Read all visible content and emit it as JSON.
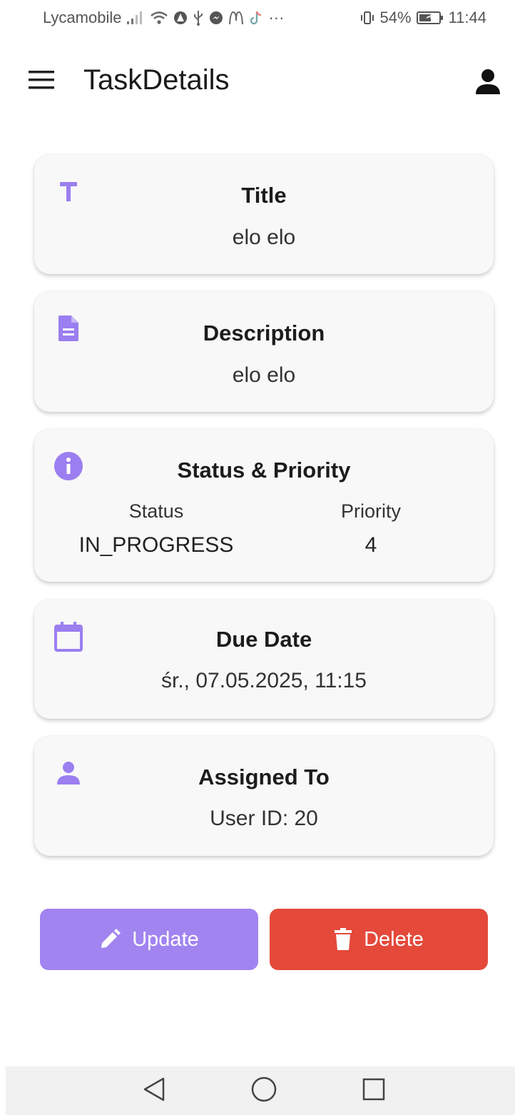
{
  "status_bar": {
    "carrier": "Lycamobile",
    "more": "···",
    "battery": "54%",
    "time": "11:44"
  },
  "app_bar": {
    "title": "TaskDetails"
  },
  "cards": {
    "title": {
      "label": "Title",
      "value": "elo elo",
      "icon": "title-t-icon"
    },
    "description": {
      "label": "Description",
      "value": "elo elo",
      "icon": "document-icon"
    },
    "status_priority": {
      "label": "Status & Priority",
      "icon": "info-icon",
      "status_label": "Status",
      "status_value": "IN_PROGRESS",
      "priority_label": "Priority",
      "priority_value": "4"
    },
    "due_date": {
      "label": "Due Date",
      "value": "śr., 07.05.2025, 11:15",
      "icon": "calendar-icon"
    },
    "assigned_to": {
      "label": "Assigned To",
      "value": "User ID: 20",
      "icon": "person-icon"
    }
  },
  "actions": {
    "update_label": "Update",
    "delete_label": "Delete"
  },
  "colors": {
    "accent": "#a184f0",
    "danger": "#e4493a",
    "icon_purple": "#9b7ef0"
  }
}
